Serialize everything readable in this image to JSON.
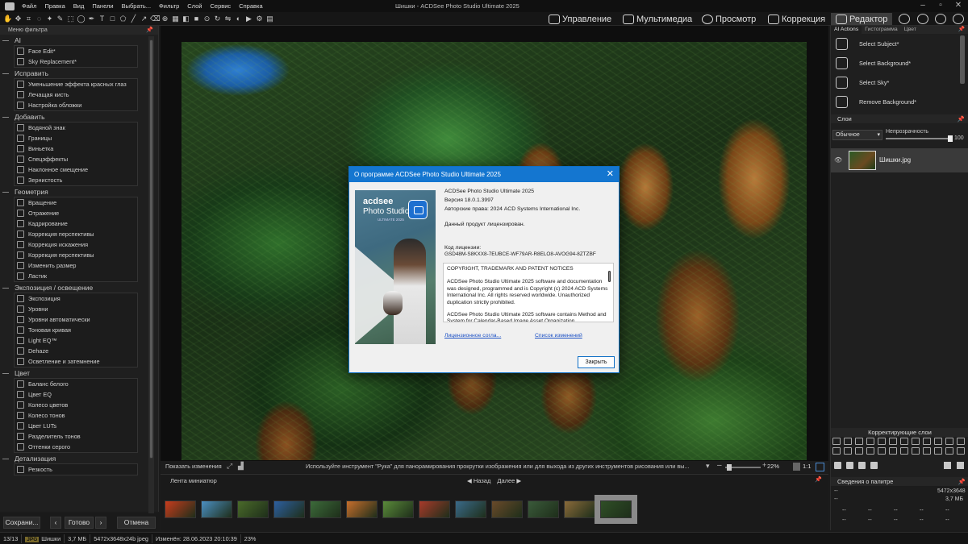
{
  "window": {
    "title": "Шишки - ACDSee Photo Studio Ultimate 2025",
    "menu": [
      "Файл",
      "Правка",
      "Вид",
      "Панели",
      "Выбрать...",
      "Фильтр",
      "Слой",
      "Сервис",
      "Справка"
    ]
  },
  "modes": {
    "manage": "Управление",
    "media": "Мультимедиа",
    "view": "Просмотр",
    "develop": "Коррекция",
    "edit": "Редактор"
  },
  "left_panel": {
    "title": "Меню фильтра",
    "sections": [
      {
        "title": "AI",
        "items": [
          "Face Edit*",
          "Sky Replacement*"
        ]
      },
      {
        "title": "Исправить",
        "items": [
          "Уменьшение эффекта красных глаз",
          "Лечащая кисть",
          "Настройка обложки"
        ]
      },
      {
        "title": "Добавить",
        "items": [
          "Водяной знак",
          "Границы",
          "Виньетка",
          "Спецэффекты",
          "Наклонное смещение",
          "Зернистость"
        ]
      },
      {
        "title": "Геометрия",
        "items": [
          "Вращение",
          "Отражение",
          "Кадрирование",
          "Коррекция перспективы",
          "Коррекция искажения",
          "Коррекция перспективы",
          "Изменить размер",
          "Ластик"
        ]
      },
      {
        "title": "Экспозиция / освещение",
        "items": [
          "Экспозиция",
          "Уровни",
          "Уровни автоматически",
          "Тоновая кривая",
          "Light EQ™",
          "Dehaze",
          "Осветление и затемнение"
        ]
      },
      {
        "title": "Цвет",
        "items": [
          "Баланс белого",
          "Цвет EQ",
          "Колесо цветов",
          "Колесо тонов",
          "Цвет LUTs",
          "Разделитель тонов",
          "Оттенки серого"
        ]
      },
      {
        "title": "Детализация",
        "items": [
          "Резкость"
        ]
      }
    ],
    "buttons": {
      "save": "Сохрани...",
      "done": "Готово",
      "cancel": "Отмена"
    }
  },
  "viewer": {
    "show_changes": "Показать изменения",
    "hint": "Используйте инструмент \"Рука\" для панорамирования прокрутки изображения или для выхода из других инструментов рисования или вы...",
    "zoom": "22%",
    "ratio": "1:1"
  },
  "filmstrip": {
    "title": "Лента миниатюр",
    "back": "Назад",
    "forward": "Далее",
    "thumbnails": [
      {
        "name": "thumb-1",
        "color": "#c83c1c"
      },
      {
        "name": "thumb-2",
        "color": "#4b8fc2"
      },
      {
        "name": "thumb-3",
        "color": "#4a6a2a"
      },
      {
        "name": "thumb-4",
        "color": "#2d5fa0"
      },
      {
        "name": "thumb-5",
        "color": "#3c6a3a"
      },
      {
        "name": "thumb-6",
        "color": "#c86e2c"
      },
      {
        "name": "thumb-7",
        "color": "#5a8a3a"
      },
      {
        "name": "thumb-8",
        "color": "#a83a2a"
      },
      {
        "name": "thumb-9",
        "color": "#3a6a8a"
      },
      {
        "name": "thumb-10",
        "color": "#6a4a2a"
      },
      {
        "name": "thumb-11",
        "color": "#3a5a3a"
      },
      {
        "name": "thumb-12",
        "color": "#8a6a3a"
      },
      {
        "name": "thumb-13",
        "color": "#2f4f26"
      }
    ]
  },
  "right_panel": {
    "tabs": [
      "AI Actions",
      "Гистограмма",
      "Цвет"
    ],
    "ai_actions": [
      "Select Subject*",
      "Select Background*",
      "Select Sky*",
      "Remove Background*"
    ],
    "layers_title": "Слои",
    "blend_mode": "Обычное",
    "opacity_label": "Непрозрачность",
    "opacity_value": "100",
    "layer_name": "Шишки.jpg",
    "adjust_title": "Корректирующие слои",
    "palette_title": "Сведения о палитре",
    "palette_rows": {
      "dim": "5472x3648",
      "size": "3,7 МБ",
      "dash": "--"
    }
  },
  "status": {
    "index": "13/13",
    "format": "JPG",
    "name": "Шишки",
    "size": "3,7 МБ",
    "dims": "5472x3648x24b jpeg",
    "modified": "Изменён: 28.06.2023 20:10:39",
    "zoom": "23%"
  },
  "about": {
    "title": "О программе ACDSee Photo Studio Ultimate 2025",
    "logo_brand": "acdsee",
    "logo_product": "Photo Studio",
    "logo_edition": "ULTIMATE 2025",
    "product": "ACDSee Photo Studio Ultimate 2025",
    "version": "Версия 18.0.1.3997",
    "copyright": "Авторские права: 2024 ACD Systems International Inc.",
    "licensed": "Данный продукт лицензирован.",
    "license_label": "Код лицензии:",
    "license_code": "GSD48M-S8KXX8-7EUBCE-WF79AR-R8ELO8-AVOG94-8ZTZBF",
    "notice_heading": "COPYRIGHT, TRADEMARK AND PATENT NOTICES",
    "notice_p1": "ACDSee Photo Studio Ultimate 2025 software and documentation was designed, programmed and is Copyright (c) 2024 ACD Systems International Inc. All rights reserved worldwide. Unauthorized duplication strictly prohibited.",
    "notice_p2": "ACDSee Photo Studio Ultimate 2025 software contains Method and System for Calendar-Based Image Asset Organization.",
    "license_link": "Лицензионное согла...",
    "changes_link": "Список изменений",
    "close_button": "Закрыть"
  }
}
